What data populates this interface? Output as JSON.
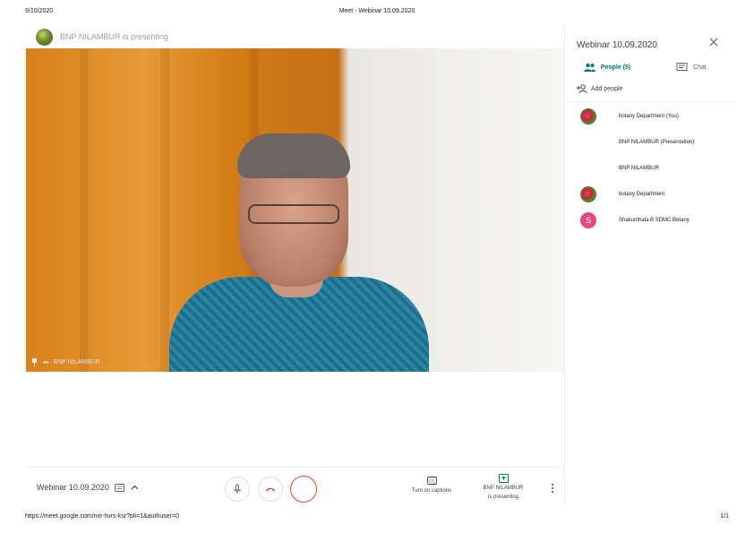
{
  "print_header": {
    "date": "9/10/2020",
    "title": "Meet - Webinar 10.09.2020"
  },
  "print_footer": {
    "url": "https://meet.google.com/nxt-hvrs-ksr?pli=1&authuser=0",
    "page": "1/1"
  },
  "presenter_bar": {
    "text": "BNP NILAMBUR is presenting"
  },
  "video_tile": {
    "label": "BNP NILAMBUR",
    "icons": [
      "pin-icon",
      "more-dots-icon"
    ]
  },
  "side_panel": {
    "title": "Webinar 10.09.2020",
    "tabs": [
      {
        "label": "People (5)",
        "icon": "people-icon",
        "active": true
      },
      {
        "label": "Chat",
        "icon": "chat-icon",
        "active": false
      }
    ],
    "add_people_label": "Add people",
    "people": [
      {
        "name": "botany Department (You)",
        "avatar": "flower"
      },
      {
        "name": "BNP NILAMBUR (Presentation)",
        "avatar": "none"
      },
      {
        "name": "BNP NILAMBUR",
        "avatar": "none"
      },
      {
        "name": "botany Department",
        "avatar": "flower"
      },
      {
        "name": "Shakunthala B SDMC Botany",
        "avatar": "letter",
        "initial": "S"
      }
    ]
  },
  "bottom_bar": {
    "meeting_title": "Webinar 10.09.2020",
    "captions_label": "Turn on captions",
    "presenting_line1": "BNP NILAMBUR",
    "presenting_line2": "is presenting"
  },
  "colors": {
    "accent": "#00796b",
    "hangup": "#ea4335",
    "avatar_letter": "#e8477b"
  }
}
